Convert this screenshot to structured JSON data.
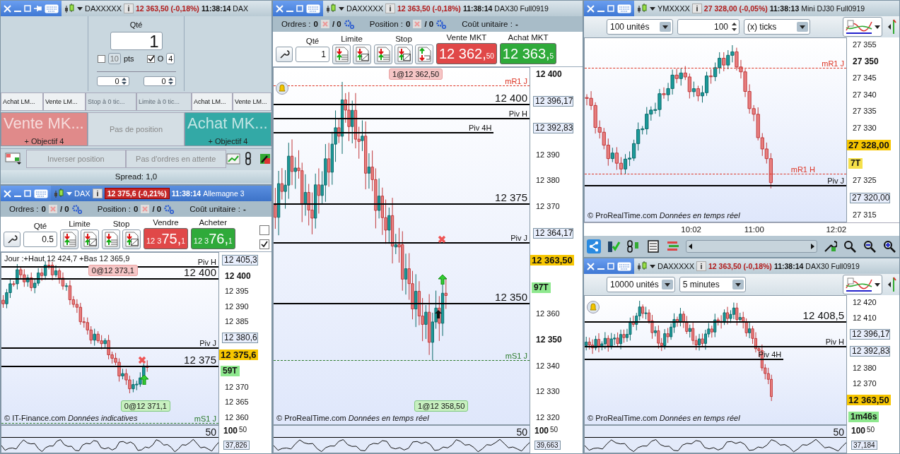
{
  "ticket_window": {
    "header": {
      "active": false,
      "pinned": true,
      "symbol": "DAXXXXX",
      "price": "12 363,50 (-0,18%)",
      "time": "11:38:14",
      "title": "DAX"
    },
    "qty_label": "Qté",
    "qty_value": "1",
    "pts_checked": false,
    "pts_value": "10",
    "pts_label": "pts",
    "o_checked": true,
    "o_label": "O",
    "o_value": "4",
    "spin_values": [
      "0",
      "0"
    ],
    "order_buttons": [
      {
        "label": "Achat LM...",
        "disabled": false
      },
      {
        "label": "Vente LM...",
        "disabled": false
      },
      {
        "label": "Stop à 0 tic...",
        "disabled": true
      },
      {
        "label": "Limite à 0 tic...",
        "disabled": true
      },
      {
        "label": "Achat LM...",
        "disabled": false
      },
      {
        "label": "Vente LM...",
        "disabled": false
      }
    ],
    "sell_market": {
      "label": "Vente MK...",
      "target": "+ Objectif 4"
    },
    "position_text": "Pas de position",
    "buy_market": {
      "label": "Achat MK...",
      "target": "+ Objectif 4"
    },
    "reverse_button": "Inverser position",
    "pending_text": "Pas d'ordres en attente",
    "spread": "Spread:  1,0"
  },
  "windows": [
    {
      "header": {
        "active": true,
        "pinned": false,
        "symbol": "DAX",
        "price": "12 375,6 (-0,21%)",
        "time": "11:38:14",
        "title": "Allemagne 3"
      },
      "orders_bar": {
        "orders_label": "Ordres :",
        "orders_count": "0",
        "orders_pending": "/ 0",
        "position_label": "Position :",
        "position_count": "0",
        "position_pending": "/ 0",
        "cost_label": "Coût unitaire :",
        "cost_value": "-"
      },
      "trade_bar": {
        "qty_label": "Qté",
        "qty_value": "0.5",
        "limit_label": "Limite",
        "limit_buttons": [
          {
            "kind": "list"
          },
          {
            "kind": "edit"
          }
        ],
        "stop_label": "Stop",
        "stop_buttons": [
          {
            "kind": "list"
          },
          {
            "kind": "edit"
          }
        ],
        "sell": {
          "label": "Vendre",
          "prefix": "12 3",
          "main": "75,",
          "sup": "1"
        },
        "buy": {
          "label": "Acheter",
          "prefix": "12 3",
          "main": "76,",
          "sup": "1"
        },
        "options": [
          {
            "checked": false
          },
          {
            "checked": true
          }
        ]
      },
      "chart": {
        "info": "Jour :+Haut 12 424,7 +Bas 12 365,9",
        "alert_bell": false,
        "order_tags": [
          {
            "text": "0@12 373,1",
            "kind": "sell"
          },
          {
            "text": "0@12 371,1",
            "kind": "buy"
          }
        ],
        "lines": [
          {
            "label": "Piv H",
            "kind": "pivot"
          },
          {
            "label": "12 400",
            "kind": "round"
          },
          {
            "label": "Piv J",
            "kind": "pivot"
          },
          {
            "label": "12 375",
            "kind": "round"
          },
          {
            "label": "mS1 J",
            "kind": "support"
          }
        ],
        "axis": [
          {
            "text": "12 405,3",
            "kind": "boxed"
          },
          {
            "text": "12 400",
            "kind": "bold"
          },
          {
            "text": "12 395",
            "kind": "tick"
          },
          {
            "text": "12 390",
            "kind": "tick"
          },
          {
            "text": "12 385",
            "kind": "tick"
          },
          {
            "text": "12 380,6",
            "kind": "boxed"
          },
          {
            "text": "12 375,6",
            "kind": "current"
          },
          {
            "text": "59T",
            "kind": "countdown",
            "color": "#8ee88e"
          },
          {
            "text": "12 370",
            "kind": "tick"
          },
          {
            "text": "12 365",
            "kind": "tick"
          },
          {
            "text": "12 360",
            "kind": "tick"
          }
        ],
        "footer": "© IT-Finance.com  *Données indicatives*",
        "indicator": {
          "top_label": "100",
          "level_label": "50",
          "axis_label": "50",
          "value": "37,826"
        }
      }
    },
    {
      "header": {
        "active": false,
        "pinned": false,
        "symbol": "DAXXXXX",
        "price": "12 363,50 (-0,18%)",
        "time": "11:38:14",
        "title": "DAX30 Full0919"
      },
      "orders_bar": {
        "orders_label": "Ordres :",
        "orders_count": "0",
        "orders_pending": "/ 0",
        "position_label": "Position :",
        "position_count": "0",
        "position_pending": "/ 0",
        "cost_label": "Coût unitaire :",
        "cost_value": "-"
      },
      "trade_bar": {
        "qty_label": "Qté",
        "qty_value": "1",
        "limit_label": "Limite",
        "limit_buttons": [
          {
            "kind": "list"
          },
          {
            "kind": "edit"
          }
        ],
        "stop_label": "Stop",
        "stop_buttons": [
          {
            "kind": "list"
          },
          {
            "kind": "edit"
          },
          {
            "kind": "bracket"
          }
        ],
        "sell": {
          "label": "Vente MKT",
          "main": "12 362,",
          "sup": "50"
        },
        "buy": {
          "label": "Achat MKT",
          "main": "12 363,",
          "sup": "5"
        }
      },
      "chart": {
        "alert_bell": true,
        "order_tags": [
          {
            "text": "1@12 362,50",
            "kind": "sell"
          },
          {
            "text": "1@12 358,50",
            "kind": "buy"
          }
        ],
        "lines": [
          {
            "label": "mR1 J",
            "kind": "resistance"
          },
          {
            "label": "12 400",
            "kind": "round"
          },
          {
            "label": "Piv H",
            "kind": "pivot"
          },
          {
            "label": "Piv 4H",
            "kind": "pivot"
          },
          {
            "label": "12 375",
            "kind": "round"
          },
          {
            "label": "Piv J",
            "kind": "pivot"
          },
          {
            "label": "12 350",
            "kind": "round"
          },
          {
            "label": "mS1 J",
            "kind": "support"
          }
        ],
        "axis": [
          {
            "text": "12 400",
            "kind": "bold"
          },
          {
            "text": "12 396,17",
            "kind": "boxed"
          },
          {
            "text": "12 392,83",
            "kind": "boxed"
          },
          {
            "text": "12 390",
            "kind": "tick"
          },
          {
            "text": "12 380",
            "kind": "tick"
          },
          {
            "text": "12 370",
            "kind": "tick"
          },
          {
            "text": "12 364,17",
            "kind": "boxed"
          },
          {
            "text": "12 363,50",
            "kind": "current"
          },
          {
            "text": "97T",
            "kind": "countdown",
            "color": "#8ee88e"
          },
          {
            "text": "12 360",
            "kind": "tick"
          },
          {
            "text": "12 350",
            "kind": "bold"
          },
          {
            "text": "12 340",
            "kind": "tick"
          },
          {
            "text": "12 330",
            "kind": "tick"
          },
          {
            "text": "12 320",
            "kind": "tick"
          }
        ],
        "footer": "© ProRealTime.com  *Données en temps réel*",
        "indicator": {
          "top_label": "100",
          "level_label": "50",
          "axis_label": "50",
          "value": "39,663"
        }
      }
    },
    {
      "header": {
        "active": false,
        "pinned": false,
        "symbol": "YMXXXX",
        "price": "27 328,00 (-0,05%)",
        "time": "11:38:13",
        "title": "Mini DJ30 Full0919"
      },
      "toolbar": [
        {
          "kind": "dropdown",
          "value": "100 unités"
        },
        {
          "kind": "spinner",
          "value": "100"
        },
        {
          "kind": "dropdown",
          "value": "(x) ticks"
        }
      ],
      "chart": {
        "alert_bell": false,
        "lines": [
          {
            "label": "mR1 J",
            "kind": "resistance"
          },
          {
            "label": "mR1 H",
            "kind": "resistance"
          },
          {
            "label": "Piv J",
            "kind": "pivot"
          }
        ],
        "axis": [
          {
            "text": "27 355",
            "kind": "tick"
          },
          {
            "text": "27 350",
            "kind": "bold"
          },
          {
            "text": "27 345",
            "kind": "tick"
          },
          {
            "text": "27 340",
            "kind": "tick"
          },
          {
            "text": "27 335",
            "kind": "tick"
          },
          {
            "text": "27 330",
            "kind": "tick"
          },
          {
            "text": "27 328,00",
            "kind": "current"
          },
          {
            "text": "7T",
            "kind": "countdown",
            "color": "#f5e04a"
          },
          {
            "text": "27 325",
            "kind": "tick"
          },
          {
            "text": "27 320,00",
            "kind": "boxed"
          },
          {
            "text": "27 315",
            "kind": "tick"
          }
        ],
        "footer": "© ProRealTime.com  *Données en temps réel*",
        "time_axis": [
          "10:02",
          "11:00",
          "12:02"
        ]
      }
    },
    {
      "header": {
        "active": false,
        "pinned": false,
        "symbol": "DAXXXXX",
        "price": "12 363,50 (-0,18%)",
        "time": "11:38:14",
        "title": "DAX30 Full0919"
      },
      "toolbar": [
        {
          "kind": "dropdown",
          "value": "10000 unités"
        },
        {
          "kind": "dropdown",
          "value": "5 minutes"
        }
      ],
      "chart": {
        "alert_bell": true,
        "lines": [
          {
            "label": "12 408,5",
            "kind": "round"
          },
          {
            "label": "Piv H",
            "kind": "pivot"
          },
          {
            "label": "Piv 4H",
            "kind": "pivot"
          }
        ],
        "axis": [
          {
            "text": "12 420",
            "kind": "tick"
          },
          {
            "text": "12 410",
            "kind": "tick"
          },
          {
            "text": "12 396,17",
            "kind": "boxed"
          },
          {
            "text": "12 392,83",
            "kind": "boxed"
          },
          {
            "text": "12 380",
            "kind": "tick"
          },
          {
            "text": "12 370",
            "kind": "tick"
          },
          {
            "text": "12 363,50",
            "kind": "current"
          },
          {
            "text": "1m46s",
            "kind": "countdown",
            "color": "#8ee88e"
          }
        ],
        "footer": "© ProRealTime.com  *Données en temps réel*",
        "indicator": {
          "top_label": "100",
          "level_label": "50",
          "axis_label": "50",
          "value": "37,184"
        }
      }
    }
  ]
}
